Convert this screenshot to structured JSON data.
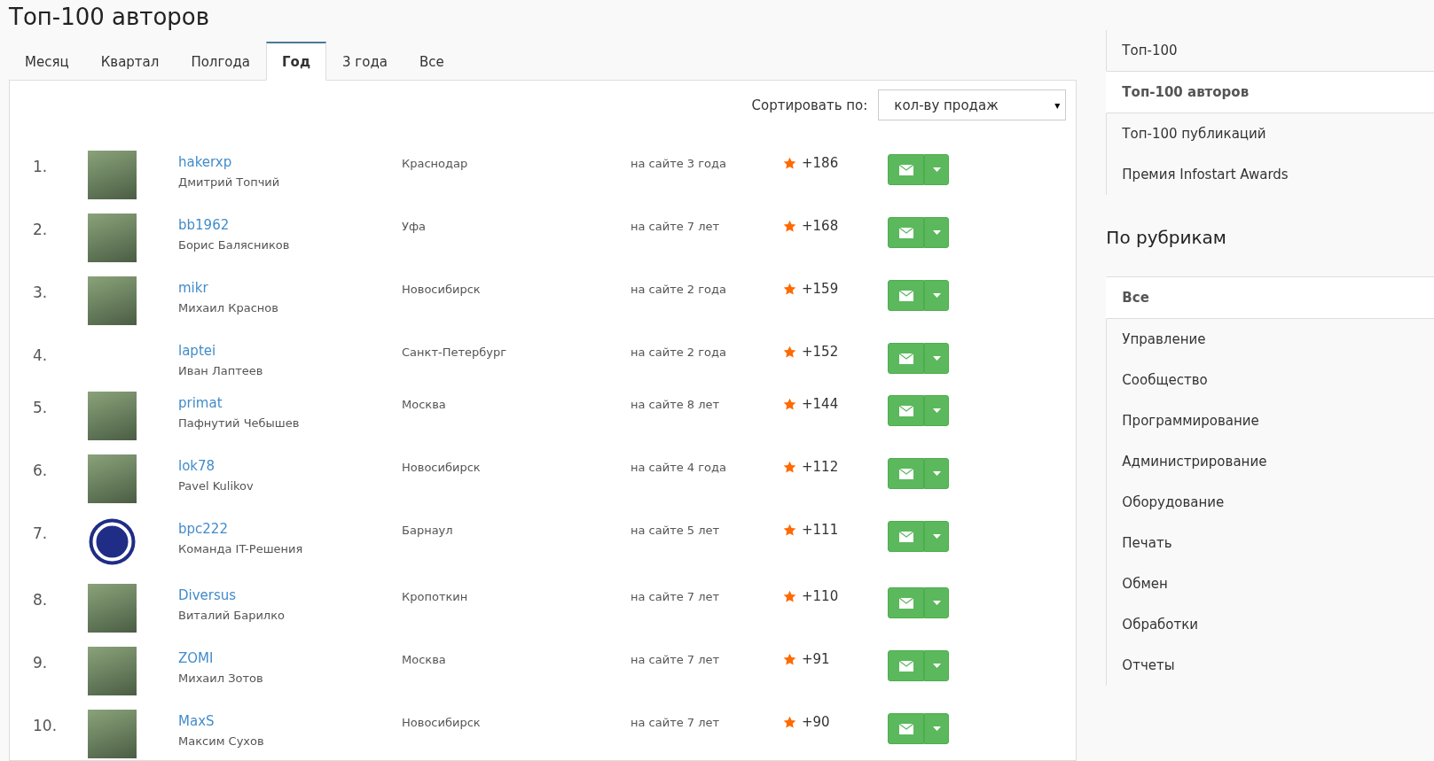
{
  "title": "Топ-100 авторов",
  "tabs": [
    {
      "label": "Месяц",
      "selected": false
    },
    {
      "label": "Квартал",
      "selected": false
    },
    {
      "label": "Полгода",
      "selected": false
    },
    {
      "label": "Год",
      "selected": true
    },
    {
      "label": "3 года",
      "selected": false
    },
    {
      "label": "Все",
      "selected": false
    }
  ],
  "sort": {
    "label": "Сортировать по:",
    "value": "кол-ву продаж",
    "caret": "▾"
  },
  "authors": [
    {
      "rank": "1.",
      "kind": "photo",
      "login": "hakerxp",
      "name": "Дмитрий Топчий",
      "city": "Краснодар",
      "tenure": "на сайте 3 года",
      "rating": "+186"
    },
    {
      "rank": "2.",
      "kind": "photo",
      "login": "bb1962",
      "name": "Борис Балясников",
      "city": "Уфа",
      "tenure": "на сайте 7 лет",
      "rating": "+168"
    },
    {
      "rank": "3.",
      "kind": "photo",
      "login": "mikr",
      "name": "Михаил Краснов",
      "city": "Новосибирск",
      "tenure": "на сайте 2 года",
      "rating": "+159"
    },
    {
      "rank": "4.",
      "kind": "plain",
      "login": "laptei",
      "name": "Иван Лаптеев",
      "city": "Санкт-Петербург",
      "tenure": "на сайте 2 года",
      "rating": "+152"
    },
    {
      "rank": "5.",
      "kind": "photo",
      "login": "primat",
      "name": "Пафнутий Чебышев",
      "city": "Москва",
      "tenure": "на сайте 8 лет",
      "rating": "+144"
    },
    {
      "rank": "6.",
      "kind": "photo",
      "login": "lok78",
      "name": "Pavel Kulikov",
      "city": "Новосибирск",
      "tenure": "на сайте 4 года",
      "rating": "+112"
    },
    {
      "rank": "7.",
      "kind": "logo",
      "login": "bpc222",
      "name": "Команда IT-Решения",
      "city": "Барнаул",
      "tenure": "на сайте 5 лет",
      "rating": "+111"
    },
    {
      "rank": "8.",
      "kind": "photo",
      "login": "Diversus",
      "name": "Виталий Барилко",
      "city": "Кропоткин",
      "tenure": "на сайте 7 лет",
      "rating": "+110"
    },
    {
      "rank": "9.",
      "kind": "photo",
      "login": "ZOMI",
      "name": "Михаил Зотов",
      "city": "Москва",
      "tenure": "на сайте 7 лет",
      "rating": "+91"
    },
    {
      "rank": "10.",
      "kind": "photo",
      "login": "MaxS",
      "name": "Максим Сухов",
      "city": "Новосибирск",
      "tenure": "на сайте 7 лет",
      "rating": "+90"
    }
  ],
  "sidebar": {
    "nav": [
      {
        "label": "Топ-100",
        "selected": false
      },
      {
        "label": "Топ-100 авторов",
        "selected": true
      },
      {
        "label": "Топ-100 публикаций",
        "selected": false
      },
      {
        "label": "Премия Infostart Awards",
        "selected": false
      }
    ],
    "rubrics_title": "По рубрикам",
    "rubrics": [
      {
        "label": "Все",
        "selected": true
      },
      {
        "label": "Управление",
        "selected": false
      },
      {
        "label": "Сообщество",
        "selected": false
      },
      {
        "label": "Программирование",
        "selected": false
      },
      {
        "label": "Администрирование",
        "selected": false
      },
      {
        "label": "Оборудование",
        "selected": false
      },
      {
        "label": "Печать",
        "selected": false
      },
      {
        "label": "Обмен",
        "selected": false
      },
      {
        "label": "Обработки",
        "selected": false
      },
      {
        "label": "Отчеты",
        "selected": false
      }
    ]
  }
}
